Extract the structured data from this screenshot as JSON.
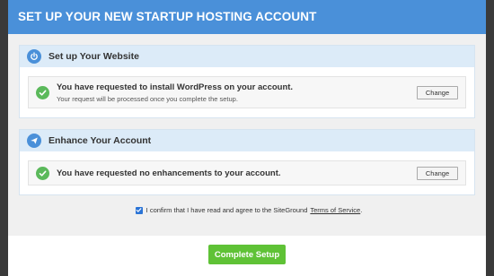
{
  "modal": {
    "title": "SET UP YOUR NEW STARTUP HOSTING ACCOUNT"
  },
  "sections": {
    "website": {
      "title": "Set up Your Website",
      "icon": "power-icon",
      "notice_main": "You have requested to install WordPress on your account.",
      "notice_sub": "Your request will be processed once you complete the setup.",
      "change_label": "Change"
    },
    "enhance": {
      "title": "Enhance Your Account",
      "icon": "paper-plane-icon",
      "notice_main": "You have requested no enhancements to your account.",
      "change_label": "Change"
    }
  },
  "confirm": {
    "checked": true,
    "text": "I confirm that I have read and agree to the SiteGround",
    "link": "Terms of Service",
    "suffix": "."
  },
  "footer": {
    "complete_label": "Complete Setup"
  },
  "colors": {
    "header": "#4a90d9",
    "section_head": "#dcebf8",
    "check": "#5bb95b",
    "complete_button": "#5fc236"
  }
}
